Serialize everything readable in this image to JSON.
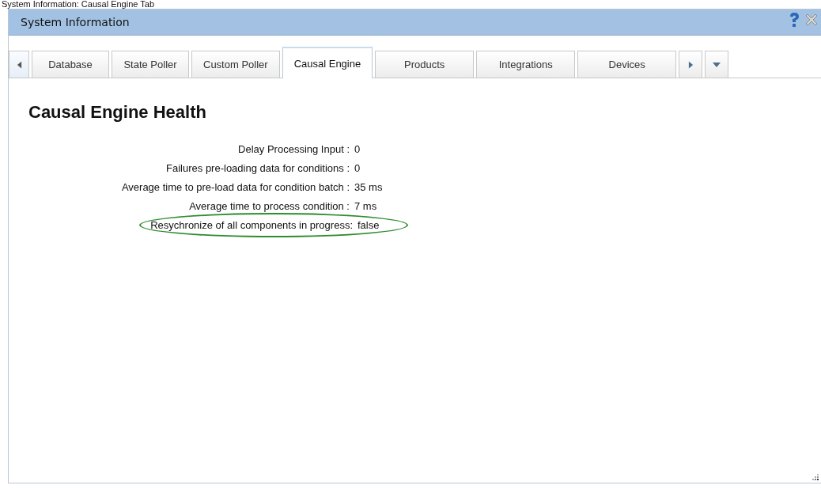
{
  "caption": "System Information: Causal Engine Tab",
  "window": {
    "title": "System Information"
  },
  "tabs": [
    {
      "label": "Database",
      "selected": false
    },
    {
      "label": "State Poller",
      "selected": false
    },
    {
      "label": "Custom Poller",
      "selected": false
    },
    {
      "label": "Causal Engine",
      "selected": true
    },
    {
      "label": "Products",
      "selected": false
    },
    {
      "label": "Integrations",
      "selected": false
    },
    {
      "label": "Devices",
      "selected": false
    }
  ],
  "panel": {
    "heading": "Causal Engine Health",
    "rows": [
      {
        "label": "Delay Processing Input :",
        "value": "0",
        "highlighted": false
      },
      {
        "label": "Failures pre-loading data for conditions :",
        "value": "0",
        "highlighted": false
      },
      {
        "label": "Average time to pre-load data for condition batch :",
        "value": "35 ms",
        "highlighted": false
      },
      {
        "label": "Average time to process condition :",
        "value": "7 ms",
        "highlighted": false
      },
      {
        "label": "Resychronize of all components in progress:",
        "value": "false",
        "highlighted": true
      }
    ]
  }
}
